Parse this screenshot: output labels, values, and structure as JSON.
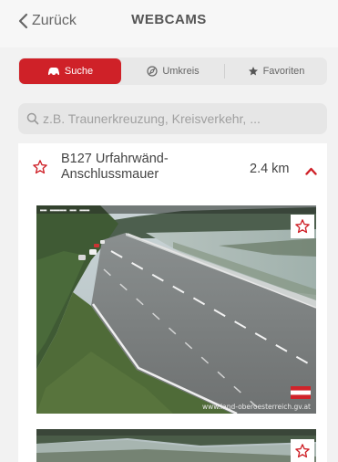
{
  "nav": {
    "back_label": "Zurück",
    "title": "WEBCAMS",
    "back_icon": "chevron-left-icon"
  },
  "tabs": [
    {
      "label": "Suche",
      "icon": "car-icon",
      "active": true
    },
    {
      "label": "Umkreis",
      "icon": "compass-icon",
      "active": false
    },
    {
      "label": "Favoriten",
      "icon": "star-filled-icon",
      "active": false
    }
  ],
  "search": {
    "placeholder": "z.B. Traunerkreuzung, Kreisverkehr, ...",
    "value": "",
    "icon": "search-icon"
  },
  "webcam": {
    "name": "B127 Urfahrwänd-Anschlussmauer",
    "distance": "2.4 km",
    "expanded": true,
    "favorite": false,
    "watermark": "www.land-oberoesterreich.gv.at"
  },
  "colors": {
    "accent": "#cf2128",
    "background": "#f2f2f2"
  }
}
